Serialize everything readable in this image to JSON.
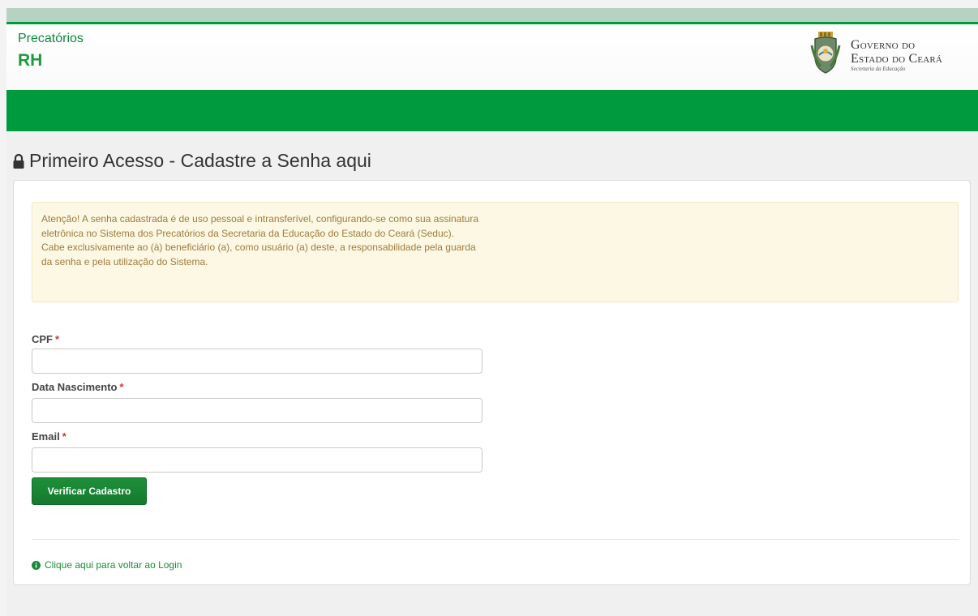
{
  "header": {
    "app_subtitle": "Precatórios",
    "app_title": "RH",
    "gov_line1": "Governo do",
    "gov_line2": "Estado do Ceará",
    "gov_line3": "Secretaria da Educação"
  },
  "page": {
    "title": "Primeiro Acesso - Cadastre a Senha aqui",
    "lock_icon": "lock-icon"
  },
  "alert": {
    "text": "Atenção! A senha cadastrada é de uso pessoal e intransferível, configurando-se como sua assinatura eletrônica no Sistema dos Precatórios da Secretaria da Educação do Estado do Ceará (Seduc). Cabe exclusivamente ao (à) beneficiário (a), como usuário (a) deste, a responsabilidade pela guarda da senha e pela utilização do Sistema."
  },
  "form": {
    "cpf_label": "CPF",
    "cpf_value": "",
    "birth_label": "Data Nascimento",
    "birth_value": "",
    "email_label": "Email",
    "email_value": "",
    "required_mark": "*",
    "submit_label": "Verificar Cadastro"
  },
  "footer": {
    "back_link": "Clique aqui para voltar ao Login",
    "info_icon": "info-circle-icon"
  },
  "colors": {
    "brand_green": "#009a3e",
    "alert_bg": "#fcf8e3",
    "alert_text": "#a07b3f",
    "required_red": "#c63b3b"
  }
}
